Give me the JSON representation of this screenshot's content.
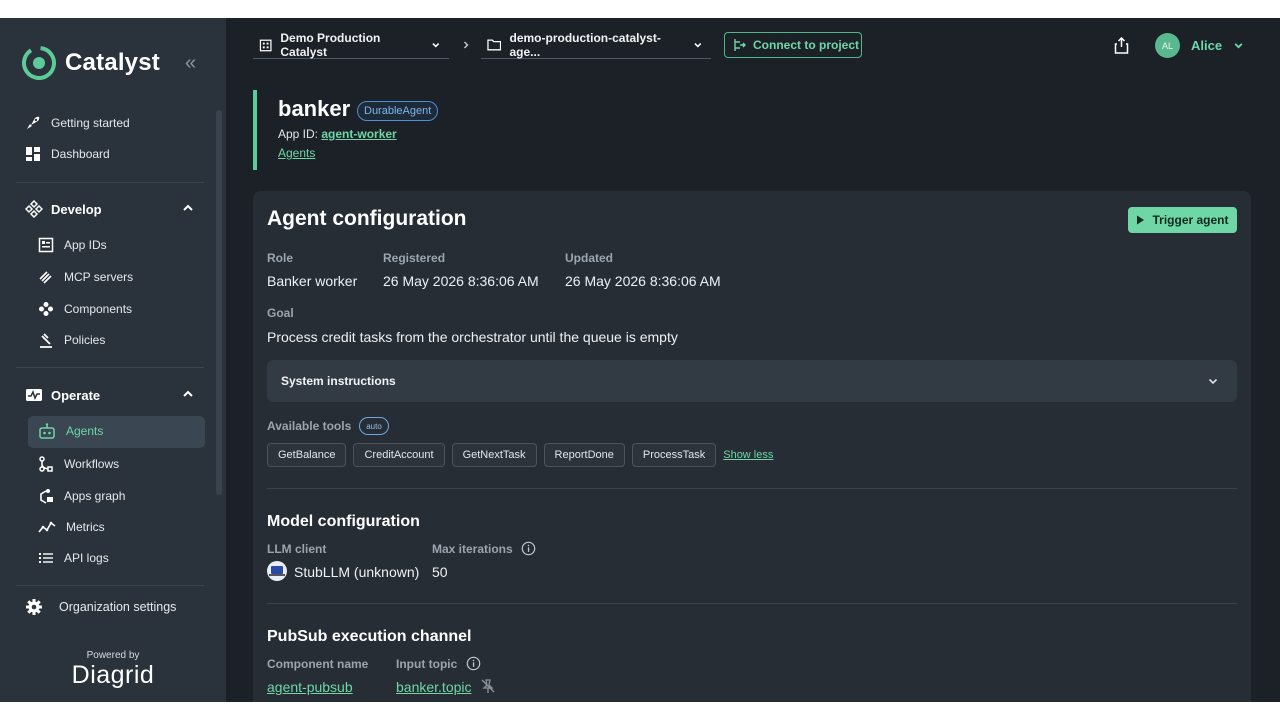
{
  "sidebar": {
    "brand": "Catalyst",
    "top_items": [
      {
        "label": "Getting started"
      },
      {
        "label": "Dashboard"
      }
    ],
    "develop": {
      "title": "Develop",
      "items": [
        {
          "label": "App IDs"
        },
        {
          "label": "MCP servers"
        },
        {
          "label": "Components"
        },
        {
          "label": "Policies"
        }
      ]
    },
    "operate": {
      "title": "Operate",
      "items": [
        {
          "label": "Agents",
          "active": true
        },
        {
          "label": "Workflows"
        },
        {
          "label": "Apps graph"
        },
        {
          "label": "Metrics"
        },
        {
          "label": "API logs"
        }
      ]
    },
    "org_settings": "Organization settings",
    "powered_by": "Powered by",
    "vendor": "Diagrid"
  },
  "header": {
    "org": "Demo Production Catalyst",
    "project": "demo-production-catalyst-age...",
    "connect_label": "Connect to project",
    "avatar_initials": "AL",
    "user_name": "Alice"
  },
  "page": {
    "title": "banker",
    "type_badge": "DurableAgent",
    "app_id_label": "App ID:",
    "app_id_value": "agent-worker",
    "breadcrumb": "Agents"
  },
  "config": {
    "title": "Agent configuration",
    "trigger_label": "Trigger agent",
    "role_label": "Role",
    "role_value": "Banker worker",
    "registered_label": "Registered",
    "registered_value": "26 May 2026 8:36:06 AM",
    "updated_label": "Updated",
    "updated_value": "26 May 2026 8:36:06 AM",
    "goal_label": "Goal",
    "goal_value": "Process credit tasks from the orchestrator until the queue is empty",
    "system_instructions_label": "System instructions",
    "tools_label": "Available tools",
    "tools_mode": "auto",
    "tools": [
      "GetBalance",
      "CreditAccount",
      "GetNextTask",
      "ReportDone",
      "ProcessTask"
    ],
    "show_less_label": "Show less"
  },
  "model": {
    "title": "Model configuration",
    "llm_label": "LLM client",
    "llm_value": "StubLLM (unknown)",
    "max_iter_label": "Max iterations",
    "max_iter_value": "50"
  },
  "pubsub": {
    "title": "PubSub execution channel",
    "component_label": "Component name",
    "component_value": "agent-pubsub",
    "topic_label": "Input topic",
    "topic_value": "banker.topic"
  },
  "colors": {
    "accent": "#6fd6a6",
    "sidebar_bg": "#2a323b",
    "main_bg": "#1c2127",
    "card_bg": "#272d34",
    "badge_blue": "#7eb4ec"
  }
}
